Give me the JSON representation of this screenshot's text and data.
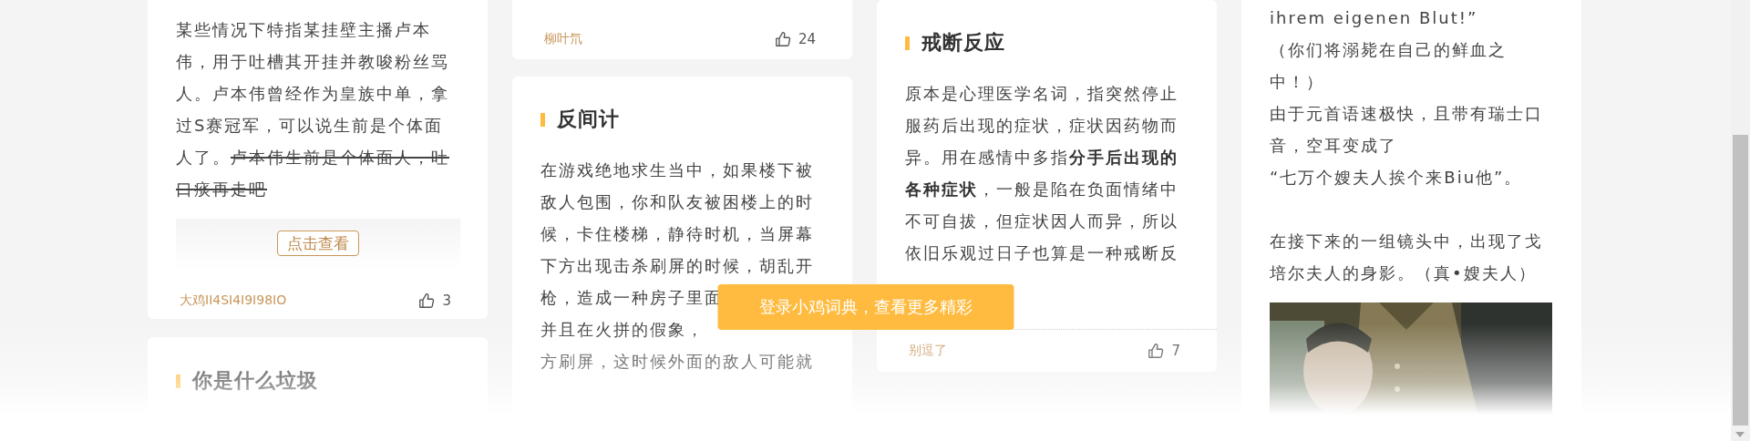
{
  "columns": [
    {
      "cards": [
        {
          "paragraphs": [
            "某些情况下特指某挂壁主播卢本伟，用于吐槽其开挂并教唆粉丝骂人。卢本伟曾经作为皇族中单，拿过S赛冠军，可以说生前是个体面人了。"
          ],
          "struck": "卢本伟生前是个体面人，吐口痰再走吧",
          "reveal_button": "点击查看",
          "author": "大鸡II4SI4I9I98IO",
          "likes": "3",
          "footer_rule": false
        },
        {
          "title": "你是什么垃圾"
        }
      ]
    },
    {
      "cards": [
        {
          "author": "柳叶氘",
          "likes": "24",
          "footer_rule": false
        },
        {
          "title": "反间计",
          "paragraphs": [
            "在游戏绝地求生当中，如果楼下被敌人包围，你和队友被困楼上的时候，卡住楼梯，静待时机，当屏幕下方出现击杀刷屏的时候，胡乱开",
            "枪，造成一种房子里面",
            "并且在火拼的假象，",
            "方刷屏，这时候外面的敌人可能就"
          ]
        }
      ]
    },
    {
      "cards": [
        {
          "title": "戒断反应",
          "paragraphs": [
            "原本是心理医学名词，指突然停止服药后出现的症状，症状因药物而异。用在感情中多指**分手后出现的各种症状**，一般是陷在负面情绪中不可自拔，但症状因人而异，所以依旧乐观过日子也算是一种戒断反"
          ],
          "author": "别逗了",
          "likes": "7",
          "footer_rule": true
        }
      ]
    },
    {
      "cards": [
        {
          "paragraphs": [
            "ihrem eigenen Blut!”",
            "（你们将溺毙在自己的鲜血之中！）",
            "由于元首语速极快，且带有瑞士口音，空耳变成了",
            "“七万个嫂夫人挨个来Biu他”。",
            "在接下来的一组镜头中，出现了戈培尔夫人的身影。（真•嫂夫人）"
          ]
        }
      ]
    }
  ],
  "login_button": {
    "label": "登录小鸡词典，查看更多精彩"
  }
}
